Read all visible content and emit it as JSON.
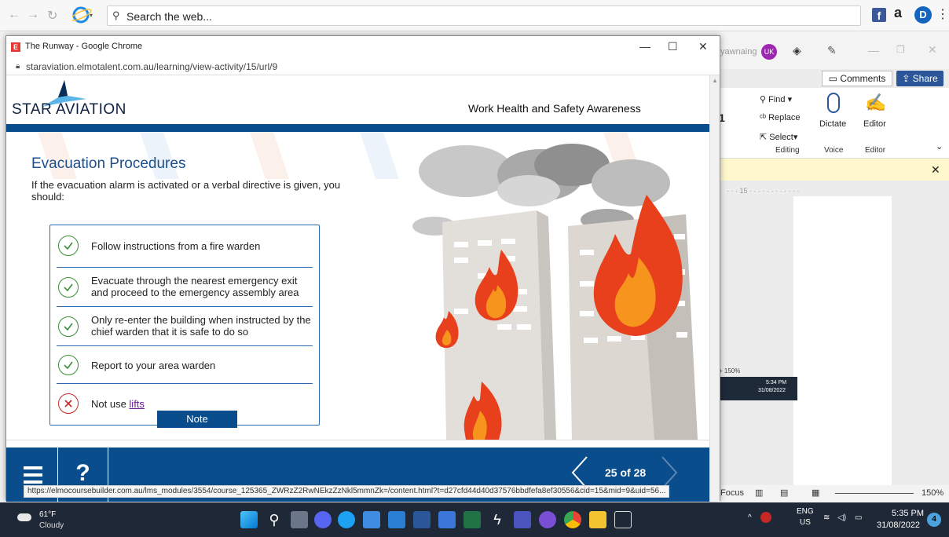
{
  "browser": {
    "search_placeholder": "Search the web...",
    "fb": "f",
    "amazon": "a",
    "d": "D",
    "more": "⋮"
  },
  "word": {
    "user": "yawnaing",
    "avatar": "UK",
    "comments": "Comments",
    "share": "Share",
    "font_size_frag": "1",
    "find": "Find",
    "replace": "Replace",
    "select": "Select",
    "editing_label": "Editing",
    "dictate": "Dictate",
    "voice_label": "Voice",
    "editor": "Editor",
    "editor_label": "Editor",
    "ruler": "· · · 15 · · · · · · · · · · · ·",
    "mini_zoom": "+ 150%",
    "mini_time": "5:34 PM",
    "mini_date": "31/08/2022",
    "focus": "Focus",
    "zoom": "150%"
  },
  "popup": {
    "title": "The Runway - Google Chrome",
    "url": "staraviation.elmotalent.com.au/learning/view-activity/15/url/9",
    "status_url": "https://elmocoursebuilder.com.au/lms_modules/3554/course_125365_ZWRzZ2RwNEkzZzNkl5mmnZk=/content.html?t=d27cfd44d40d37576bbdfefa8ef30556&cid=15&mid=9&uid=56..."
  },
  "course": {
    "logo_text_1": "STAR",
    "logo_text_2": "AVIATION",
    "header_title": "Work Health and Safety Awareness",
    "section_title": "Evacuation Procedures",
    "intro": "If the evacuation alarm is activated or a verbal directive is given, you should:",
    "items": [
      {
        "text": "Follow instructions from a fire warden",
        "type": "do"
      },
      {
        "text": "Evacuate through the nearest emergency exit and proceed to the emergency assembly area",
        "type": "do"
      },
      {
        "text": "Only re-enter the building when instructed by the chief warden that it is safe to do so",
        "type": "do"
      },
      {
        "text": "Report to your area warden",
        "type": "do"
      },
      {
        "text_prefix": "Not use ",
        "link": "lifts",
        "type": "dont"
      }
    ],
    "note_label": "Note",
    "help_label": "?",
    "page_indicator": "25 of 28"
  },
  "taskbar": {
    "temp": "61°F",
    "condition": "Cloudy",
    "lang_1": "ENG",
    "lang_2": "US",
    "time": "5:35 PM",
    "date": "31/08/2022",
    "notifications": "4"
  },
  "colors": {
    "course_blue": "#0a4d8c",
    "title_blue": "#1d4f8a",
    "check_green": "#3a8f3a",
    "cross_red": "#c62828",
    "flame_red": "#e8401c",
    "flame_orange": "#f7941d"
  }
}
